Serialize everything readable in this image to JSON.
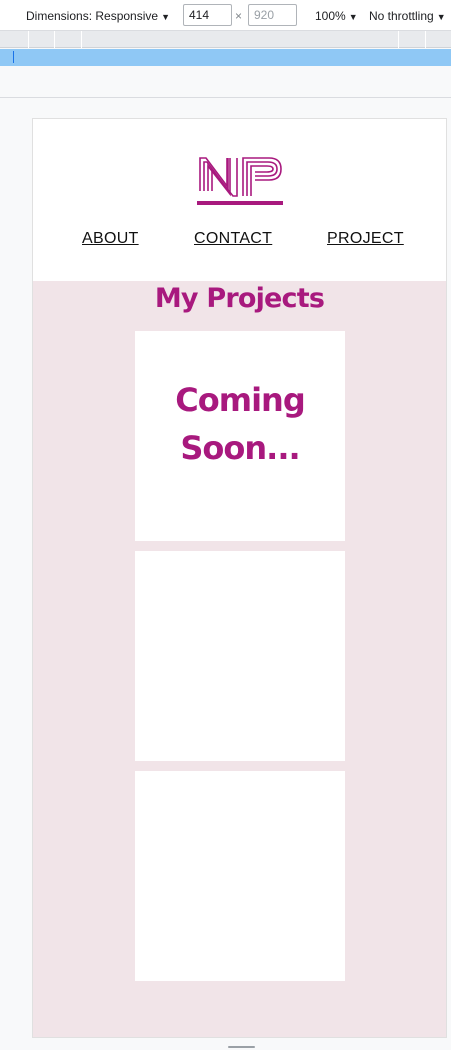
{
  "devtools": {
    "dimensions_label": "Dimensions: Responsive",
    "width_value": "414",
    "height_value": "920",
    "times_sign": "×",
    "zoom_label": "100%",
    "throttle_label": "No throttling",
    "caret": "▼"
  },
  "site": {
    "logo_text": "NP",
    "nav": {
      "about": "ABOUT",
      "contact": "CONTACT",
      "project": "PROJECT"
    },
    "page_title": "My Projects",
    "cards": [
      {
        "line1": "Coming",
        "line2": "Soon..."
      },
      {
        "line1": "",
        "line2": ""
      },
      {
        "line1": "",
        "line2": ""
      }
    ]
  },
  "colors": {
    "brand": "#a8197e",
    "main_background": "#f1e4e8",
    "ruler_blue": "#8fc8f5"
  }
}
